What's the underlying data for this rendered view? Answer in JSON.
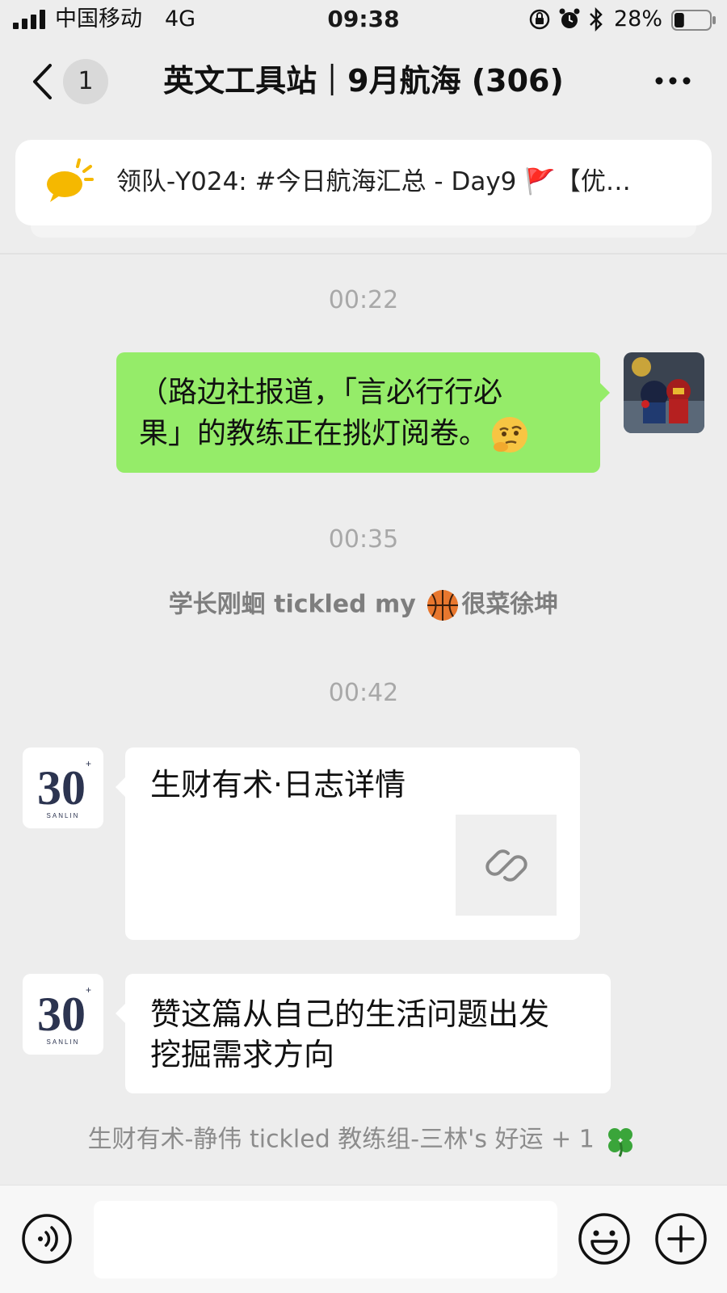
{
  "status_bar": {
    "carrier": "中国移动",
    "network": "4G",
    "time": "09:38",
    "battery_percent": "28%",
    "battery_level": 0.28
  },
  "nav": {
    "unread_count": "1",
    "title": "英文工具站｜9月航海 (306)"
  },
  "pinned": {
    "text": "领队-Y024: #今日航海汇总 - Day9 🚩【优…"
  },
  "messages": {
    "ts1": "00:22",
    "outgoing_line1": "（路边社报道，「言必行行必",
    "outgoing_line2": "果」的教练正在挑灯阅卷。",
    "ts2": "00:35",
    "tickle1_a": "学长刚蛔 tickled my ",
    "tickle1_b": "很菜徐坤",
    "ts3": "00:42",
    "card_title": "生财有术·日志详情",
    "text_line1": "赞这篇从自己的生活问题出发",
    "text_line2": "挖掘需求方向",
    "tickle2": "生财有术-静伟 tickled 教练组-三林's 好运 + 1",
    "sanlin_logo": "30",
    "sanlin_logo_sub": "SANLIN"
  },
  "colors": {
    "outgoing_bubble": "#95ec69",
    "background": "#ededed"
  },
  "icons": [
    "signal-icon",
    "lock-icon",
    "alarm-icon",
    "bluetooth-icon",
    "battery-icon",
    "back-icon",
    "more-icon",
    "sun-icon",
    "flag-icon",
    "link-icon",
    "voice-icon",
    "emoji-icon",
    "plus-icon",
    "basketball-icon",
    "clover-icon",
    "thinking-emoji-icon"
  ]
}
